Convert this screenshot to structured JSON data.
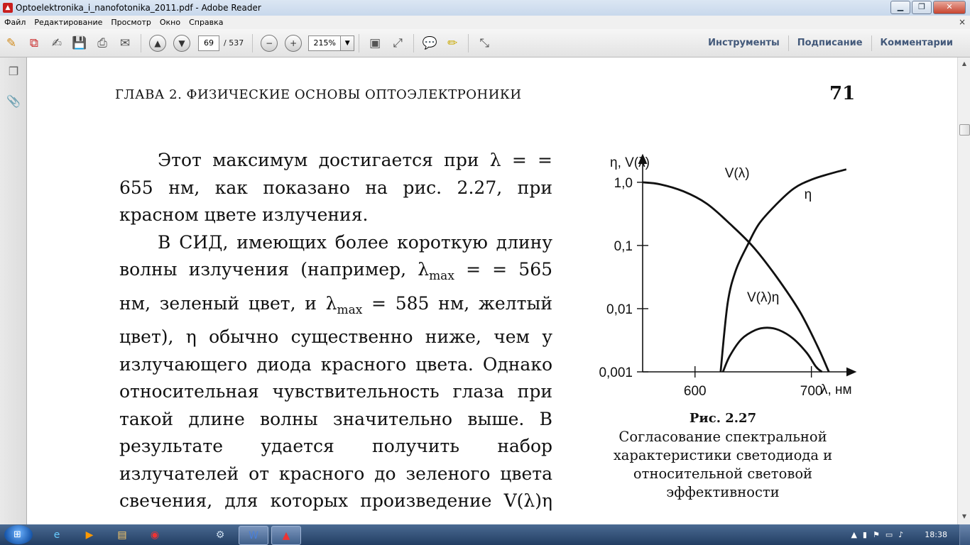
{
  "window": {
    "title": "Optoelektronika_i_nanofotonika_2011.pdf - Adobe Reader",
    "app_icon": "pdf-icon",
    "controls": [
      "minimize-icon",
      "maximize-icon",
      "close-icon"
    ]
  },
  "menubar": {
    "items": [
      "Файл",
      "Редактирование",
      "Просмотр",
      "Окно",
      "Справка"
    ],
    "close_glyph": "×"
  },
  "toolbar": {
    "current_page": "69",
    "total_pages": "/ 537",
    "zoom": "215%",
    "tools_label": "Инструменты",
    "sign_label": "Подписание",
    "comment_label": "Комментарии"
  },
  "document": {
    "running_head": "ГЛАВА 2. ФИЗИЧЕСКИЕ ОСНОВЫ ОПТОЭЛЕКТРОНИКИ",
    "page_number": "71",
    "paragraph1": "Этот максимум достигается при λ = = 655 нм, как показано на рис. 2.27, при красном цвете излучения.",
    "paragraph2_a": "В СИД, имеющих более короткую длину волны излучения (например, λ",
    "sub_max": "max",
    "paragraph2_b": " = = 565 нм, зеленый цвет, и λ",
    "paragraph2_c": " = 585 нм, желтый цвет), η обычно существенно ниже, чем у излучающего диода красного цвета. Однако относительная чувствительность глаза при такой длине волны значительно выше. В результате удается получить набор излучателей от красного до зеленого цвета свечения, для которых произведение V(λ)η одина-",
    "figure_caption_title": "Рис. 2.27",
    "figure_caption_text": "Согласование спектральной характеристики светодиода и относительной световой эффективности"
  },
  "chart_data": {
    "type": "line",
    "ylabel": "η, V(λ)",
    "xlabel": "λ, нм",
    "y_scale": "log",
    "y_ticks": [
      1.0,
      0.1,
      0.01,
      0.001
    ],
    "y_tick_labels": [
      "1,0",
      "0,1",
      "0,01",
      "0,001"
    ],
    "x_ticks": [
      600,
      700
    ],
    "x_tick_labels": [
      "600",
      "700"
    ],
    "xlim": [
      555,
      735
    ],
    "ylim": [
      0.001,
      2.4
    ],
    "series": [
      {
        "name": "V(λ)",
        "x": [
          555,
          570,
          590,
          610,
          630,
          650,
          670,
          690,
          705,
          715
        ],
        "y": [
          1.0,
          0.93,
          0.72,
          0.46,
          0.22,
          0.095,
          0.032,
          0.009,
          0.0026,
          0.001
        ]
      },
      {
        "name": "η",
        "x": [
          622,
          628,
          635,
          645,
          655,
          670,
          685,
          700,
          715,
          730
        ],
        "y": [
          0.001,
          0.012,
          0.04,
          0.1,
          0.22,
          0.45,
          0.8,
          1.1,
          1.35,
          1.6
        ]
      },
      {
        "name": "V(λ)η",
        "x": [
          624,
          630,
          640,
          652,
          662,
          672,
          684,
          696,
          704,
          709
        ],
        "y": [
          0.001,
          0.0018,
          0.0033,
          0.0046,
          0.005,
          0.0046,
          0.0034,
          0.002,
          0.0012,
          0.001
        ]
      }
    ]
  },
  "taskbar": {
    "clock": "18:38",
    "apps": [
      "ie-icon",
      "media-player-icon",
      "explorer-icon",
      "chrome-icon",
      "settings-icon",
      "word-icon",
      "acrobat-icon"
    ],
    "tray_icons": [
      "chevron-up-icon",
      "signal-icon",
      "flag-icon",
      "battery-icon",
      "volume-icon"
    ]
  }
}
